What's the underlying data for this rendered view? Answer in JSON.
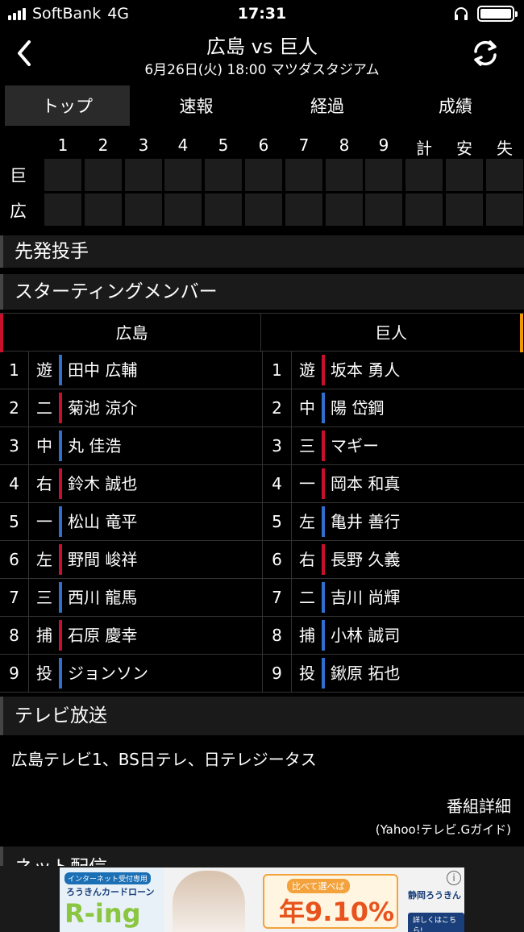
{
  "status": {
    "carrier": "SoftBank",
    "network": "4G",
    "time": "17:31"
  },
  "header": {
    "title": "広島 vs 巨人",
    "subtitle": "6月26日(火) 18:00 マツダスタジアム"
  },
  "tabs": [
    {
      "label": "トップ",
      "active": true
    },
    {
      "label": "速報",
      "active": false
    },
    {
      "label": "経過",
      "active": false
    },
    {
      "label": "成績",
      "active": false
    }
  ],
  "scoreboard": {
    "columns": [
      "1",
      "2",
      "3",
      "4",
      "5",
      "6",
      "7",
      "8",
      "9",
      "計",
      "安",
      "失"
    ],
    "teams": [
      "巨",
      "広"
    ]
  },
  "sections": {
    "pitchers": "先発投手",
    "starting": "スターティングメンバー",
    "tv": "テレビ放送",
    "partial": "ネット配信"
  },
  "lineup": {
    "home": "広島",
    "away": "巨人",
    "rows": [
      {
        "num": "1",
        "home_pos": "遊",
        "home_name": "田中 広輔",
        "away_pos": "遊",
        "away_name": "坂本 勇人"
      },
      {
        "num": "2",
        "home_pos": "二",
        "home_name": "菊池 涼介",
        "away_pos": "中",
        "away_name": "陽 岱鋼"
      },
      {
        "num": "3",
        "home_pos": "中",
        "home_name": "丸 佳浩",
        "away_pos": "三",
        "away_name": "マギー"
      },
      {
        "num": "4",
        "home_pos": "右",
        "home_name": "鈴木 誠也",
        "away_pos": "一",
        "away_name": "岡本 和真"
      },
      {
        "num": "5",
        "home_pos": "一",
        "home_name": "松山 竜平",
        "away_pos": "左",
        "away_name": "亀井 善行"
      },
      {
        "num": "6",
        "home_pos": "左",
        "home_name": "野間 峻祥",
        "away_pos": "右",
        "away_name": "長野 久義"
      },
      {
        "num": "7",
        "home_pos": "三",
        "home_name": "西川 龍馬",
        "away_pos": "二",
        "away_name": "吉川 尚輝"
      },
      {
        "num": "8",
        "home_pos": "捕",
        "home_name": "石原 慶幸",
        "away_pos": "捕",
        "away_name": "小林 誠司"
      },
      {
        "num": "9",
        "home_pos": "投",
        "home_name": "ジョンソン",
        "away_pos": "投",
        "away_name": "鍬原 拓也"
      }
    ],
    "home_bars": [
      "blue",
      "red",
      "blue",
      "red",
      "blue",
      "red",
      "blue",
      "red",
      "blue"
    ],
    "away_bars": [
      "red",
      "blue",
      "red",
      "red",
      "blue",
      "red",
      "blue",
      "blue",
      "blue"
    ]
  },
  "tv": {
    "channels": "広島テレビ1、BS日テレ、日テレジータス",
    "detail_link": "番組詳細",
    "source": "(Yahoo!テレビ.Gガイド)"
  },
  "ad": {
    "tag": "インターネット受付専用",
    "product": "ろうきんカードローン",
    "logo": "R-ing",
    "rate_tag": "比べて選べば",
    "rate": "年9.10%",
    "bank": "静岡ろうきん",
    "cta": "詳しくはこちら!"
  },
  "colors": {
    "red": "#c8102e",
    "blue": "#2f6fd0",
    "orange": "#f39800"
  }
}
